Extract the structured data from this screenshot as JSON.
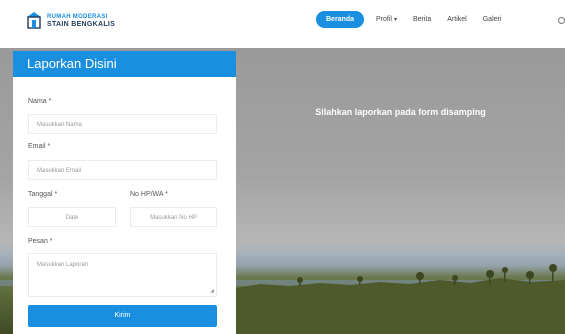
{
  "brand": {
    "line1": "RUMAH MODERASI",
    "line2": "STAIN BENGKALIS",
    "accent": "#1a8fe0"
  },
  "nav": {
    "items": [
      {
        "label": "Beranda",
        "active": true
      },
      {
        "label": "Profil",
        "dropdown": true
      },
      {
        "label": "Berita"
      },
      {
        "label": "Artikel"
      },
      {
        "label": "Galeri"
      }
    ],
    "search_icon": "search-icon"
  },
  "hero": {
    "caption": "Silahkan laporkan pada form disamping"
  },
  "form": {
    "title": "Laporkan Disini",
    "name_label": "Nama *",
    "name_placeholder": "Masukkan Nama",
    "email_label": "Email *",
    "email_placeholder": "Masukkan Email",
    "date_label": "Tanggal *",
    "date_placeholder": "Date",
    "phone_label": "No HP/WA *",
    "phone_placeholder": "Masukkan No HP",
    "message_label": "Pesan *",
    "message_placeholder": "Masukkan Laporan",
    "submit_label": "Kirim"
  }
}
